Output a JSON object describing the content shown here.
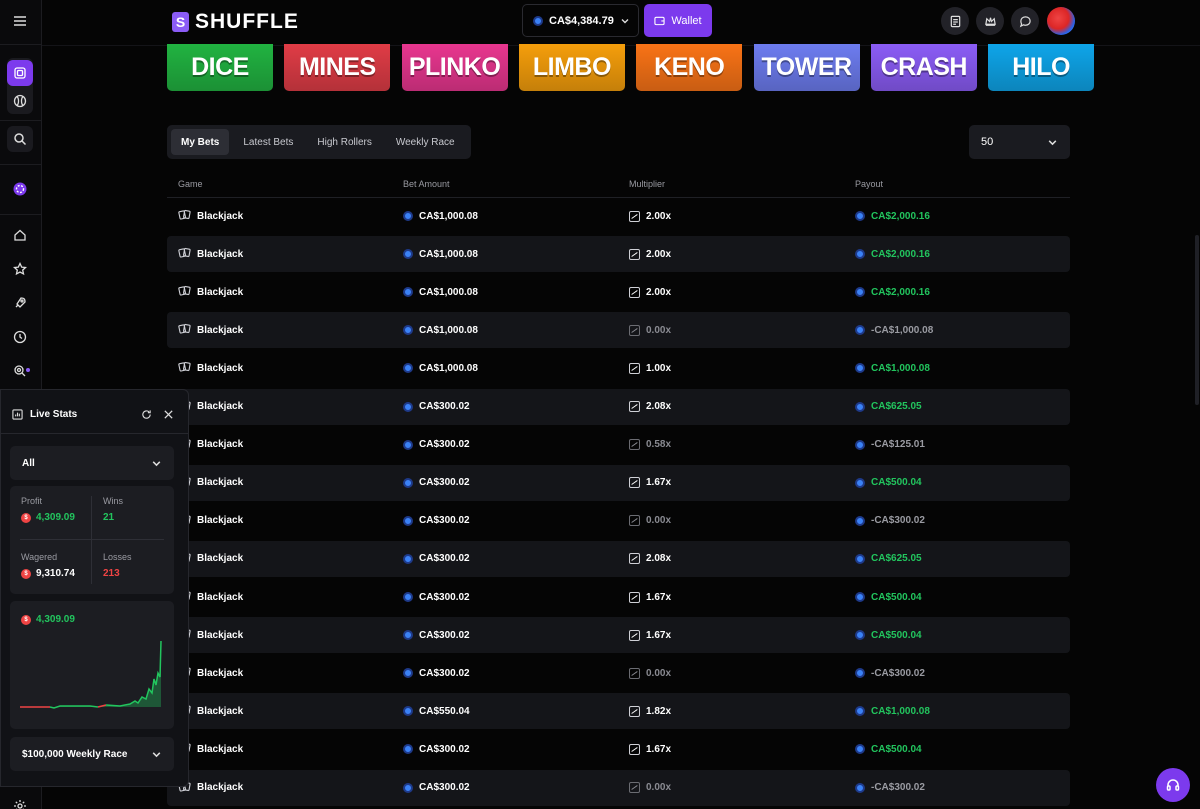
{
  "header": {
    "logo": "SHUFFLE",
    "balance": "CA$4,384.79",
    "wallet_label": "Wallet"
  },
  "game_tiles": [
    {
      "name": "DICE",
      "color": "#21b341"
    },
    {
      "name": "MINES",
      "color": "#e03c46"
    },
    {
      "name": "PLINKO",
      "color": "#e8368f"
    },
    {
      "name": "LIMBO",
      "color": "#f59e0b"
    },
    {
      "name": "KENO",
      "color": "#f97316"
    },
    {
      "name": "TOWER",
      "color": "#6d7cf0"
    },
    {
      "name": "CRASH",
      "color": "#8b5cf6"
    },
    {
      "name": "HILO",
      "color": "#0ea5e9"
    }
  ],
  "tabs": [
    {
      "label": "My Bets"
    },
    {
      "label": "Latest Bets"
    },
    {
      "label": "High Rollers"
    },
    {
      "label": "Weekly Race"
    }
  ],
  "limit": "50",
  "table": {
    "headers": [
      "Game",
      "Bet Amount",
      "Multiplier",
      "Payout"
    ],
    "rows": [
      {
        "game": "Blackjack",
        "bet": "CA$1,000.08",
        "mult": "2.00x",
        "payout": "CA$2,000.16",
        "win": true
      },
      {
        "game": "Blackjack",
        "bet": "CA$1,000.08",
        "mult": "2.00x",
        "payout": "CA$2,000.16",
        "win": true
      },
      {
        "game": "Blackjack",
        "bet": "CA$1,000.08",
        "mult": "2.00x",
        "payout": "CA$2,000.16",
        "win": true
      },
      {
        "game": "Blackjack",
        "bet": "CA$1,000.08",
        "mult": "0.00x",
        "payout": "-CA$1,000.08",
        "win": false
      },
      {
        "game": "Blackjack",
        "bet": "CA$1,000.08",
        "mult": "1.00x",
        "payout": "CA$1,000.08",
        "win": true
      },
      {
        "game": "Blackjack",
        "bet": "CA$300.02",
        "mult": "2.08x",
        "payout": "CA$625.05",
        "win": true
      },
      {
        "game": "Blackjack",
        "bet": "CA$300.02",
        "mult": "0.58x",
        "payout": "-CA$125.01",
        "win": false
      },
      {
        "game": "Blackjack",
        "bet": "CA$300.02",
        "mult": "1.67x",
        "payout": "CA$500.04",
        "win": true
      },
      {
        "game": "Blackjack",
        "bet": "CA$300.02",
        "mult": "0.00x",
        "payout": "-CA$300.02",
        "win": false
      },
      {
        "game": "Blackjack",
        "bet": "CA$300.02",
        "mult": "2.08x",
        "payout": "CA$625.05",
        "win": true
      },
      {
        "game": "Blackjack",
        "bet": "CA$300.02",
        "mult": "1.67x",
        "payout": "CA$500.04",
        "win": true
      },
      {
        "game": "Blackjack",
        "bet": "CA$300.02",
        "mult": "1.67x",
        "payout": "CA$500.04",
        "win": true
      },
      {
        "game": "Blackjack",
        "bet": "CA$300.02",
        "mult": "0.00x",
        "payout": "-CA$300.02",
        "win": false
      },
      {
        "game": "Blackjack",
        "bet": "CA$550.04",
        "mult": "1.82x",
        "payout": "CA$1,000.08",
        "win": true
      },
      {
        "game": "Blackjack",
        "bet": "CA$300.02",
        "mult": "1.67x",
        "payout": "CA$500.04",
        "win": true
      },
      {
        "game": "Blackjack",
        "bet": "CA$300.02",
        "mult": "0.00x",
        "payout": "-CA$300.02",
        "win": false
      }
    ]
  },
  "live_stats": {
    "title": "Live Stats",
    "filter": "All",
    "profit_label": "Profit",
    "profit": "4,309.09",
    "wins_label": "Wins",
    "wins": "21",
    "wagered_label": "Wagered",
    "wagered": "9,310.74",
    "losses_label": "Losses",
    "losses": "213",
    "chart_value": "4,309.09",
    "race": "$100,000 Weekly Race"
  },
  "colors": {
    "accent": "#7c3aed",
    "win": "#22c55e",
    "loss": "#ef4444"
  }
}
